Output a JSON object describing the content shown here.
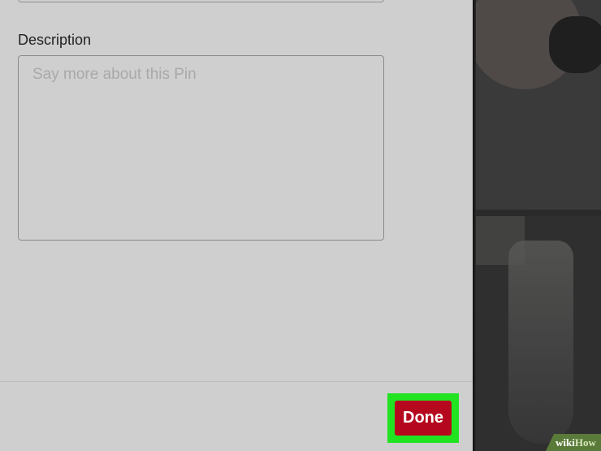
{
  "form": {
    "description_label": "Description",
    "description_placeholder": "Say more about this Pin",
    "description_value": ""
  },
  "footer": {
    "done_label": "Done"
  },
  "watermark": {
    "part1": "wiki",
    "part2": "How"
  },
  "colors": {
    "done_button": "#b5081e",
    "highlight": "#22e322",
    "panel_bg": "#cfcfcf",
    "backdrop": "#2a2a2a"
  }
}
